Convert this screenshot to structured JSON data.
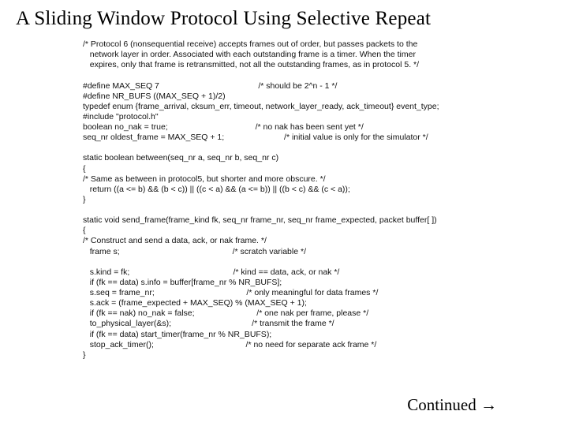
{
  "title": "A Sliding Window Protocol Using Selective Repeat",
  "continued": "Continued →",
  "code": {
    "l01": "/* Protocol 6 (nonsequential receive) accepts frames out of order, but passes packets to the",
    "l02": "   network layer in order. Associated with each outstanding frame is a timer. When the timer",
    "l03": "   expires, only that frame is retransmitted, not all the outstanding frames, as in protocol 5. */",
    "l04": "",
    "l05": "#define MAX_SEQ 7                                           /* should be 2^n - 1 */",
    "l06": "#define NR_BUFS ((MAX_SEQ + 1)/2)",
    "l07": "typedef enum {frame_arrival, cksum_err, timeout, network_layer_ready, ack_timeout} event_type;",
    "l08": "#include \"protocol.h\"",
    "l09": "boolean no_nak = true;                                      /* no nak has been sent yet */",
    "l10": "seq_nr oldest_frame = MAX_SEQ + 1;                          /* initial value is only for the simulator */",
    "l11": "",
    "l12": "static boolean between(seq_nr a, seq_nr b, seq_nr c)",
    "l13": "{",
    "l14": "/* Same as between in protocol5, but shorter and more obscure. */",
    "l15": "   return ((a <= b) && (b < c)) || ((c < a) && (a <= b)) || ((b < c) && (c < a));",
    "l16": "}",
    "l17": "",
    "l18": "static void send_frame(frame_kind fk, seq_nr frame_nr, seq_nr frame_expected, packet buffer[ ])",
    "l19": "{",
    "l20": "/* Construct and send a data, ack, or nak frame. */",
    "l21": "   frame s;                                                 /* scratch variable */",
    "l22": "",
    "l23": "   s.kind = fk;                                             /* kind == data, ack, or nak */",
    "l24": "   if (fk == data) s.info = buffer[frame_nr % NR_BUFS];",
    "l25": "   s.seq = frame_nr;                                        /* only meaningful for data frames */",
    "l26": "   s.ack = (frame_expected + MAX_SEQ) % (MAX_SEQ + 1);",
    "l27": "   if (fk == nak) no_nak = false;                           /* one nak per frame, please */",
    "l28": "   to_physical_layer(&s);                                   /* transmit the frame */",
    "l29": "   if (fk == data) start_timer(frame_nr % NR_BUFS);",
    "l30": "   stop_ack_timer();                                        /* no need for separate ack frame */",
    "l31": "}"
  }
}
